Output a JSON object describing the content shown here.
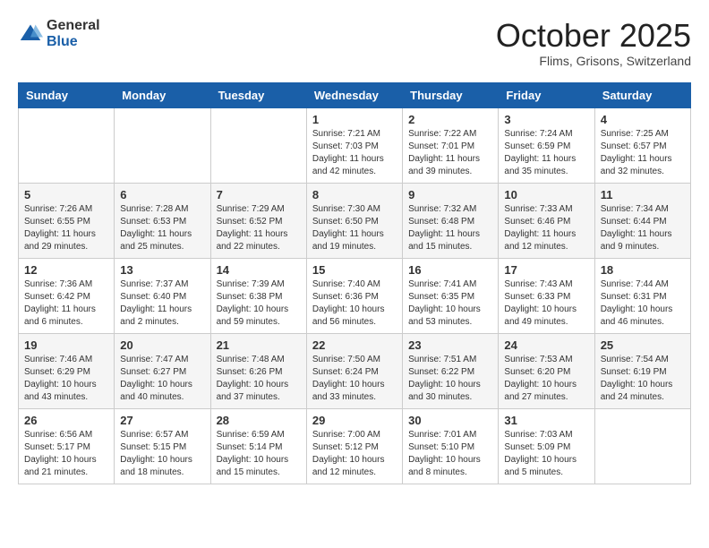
{
  "header": {
    "logo_general": "General",
    "logo_blue": "Blue",
    "month": "October 2025",
    "location": "Flims, Grisons, Switzerland"
  },
  "weekdays": [
    "Sunday",
    "Monday",
    "Tuesday",
    "Wednesday",
    "Thursday",
    "Friday",
    "Saturday"
  ],
  "rows": [
    {
      "style": "white",
      "cells": [
        {
          "day": "",
          "info": ""
        },
        {
          "day": "",
          "info": ""
        },
        {
          "day": "",
          "info": ""
        },
        {
          "day": "1",
          "info": "Sunrise: 7:21 AM\nSunset: 7:03 PM\nDaylight: 11 hours\nand 42 minutes."
        },
        {
          "day": "2",
          "info": "Sunrise: 7:22 AM\nSunset: 7:01 PM\nDaylight: 11 hours\nand 39 minutes."
        },
        {
          "day": "3",
          "info": "Sunrise: 7:24 AM\nSunset: 6:59 PM\nDaylight: 11 hours\nand 35 minutes."
        },
        {
          "day": "4",
          "info": "Sunrise: 7:25 AM\nSunset: 6:57 PM\nDaylight: 11 hours\nand 32 minutes."
        }
      ]
    },
    {
      "style": "gray",
      "cells": [
        {
          "day": "5",
          "info": "Sunrise: 7:26 AM\nSunset: 6:55 PM\nDaylight: 11 hours\nand 29 minutes."
        },
        {
          "day": "6",
          "info": "Sunrise: 7:28 AM\nSunset: 6:53 PM\nDaylight: 11 hours\nand 25 minutes."
        },
        {
          "day": "7",
          "info": "Sunrise: 7:29 AM\nSunset: 6:52 PM\nDaylight: 11 hours\nand 22 minutes."
        },
        {
          "day": "8",
          "info": "Sunrise: 7:30 AM\nSunset: 6:50 PM\nDaylight: 11 hours\nand 19 minutes."
        },
        {
          "day": "9",
          "info": "Sunrise: 7:32 AM\nSunset: 6:48 PM\nDaylight: 11 hours\nand 15 minutes."
        },
        {
          "day": "10",
          "info": "Sunrise: 7:33 AM\nSunset: 6:46 PM\nDaylight: 11 hours\nand 12 minutes."
        },
        {
          "day": "11",
          "info": "Sunrise: 7:34 AM\nSunset: 6:44 PM\nDaylight: 11 hours\nand 9 minutes."
        }
      ]
    },
    {
      "style": "white",
      "cells": [
        {
          "day": "12",
          "info": "Sunrise: 7:36 AM\nSunset: 6:42 PM\nDaylight: 11 hours\nand 6 minutes."
        },
        {
          "day": "13",
          "info": "Sunrise: 7:37 AM\nSunset: 6:40 PM\nDaylight: 11 hours\nand 2 minutes."
        },
        {
          "day": "14",
          "info": "Sunrise: 7:39 AM\nSunset: 6:38 PM\nDaylight: 10 hours\nand 59 minutes."
        },
        {
          "day": "15",
          "info": "Sunrise: 7:40 AM\nSunset: 6:36 PM\nDaylight: 10 hours\nand 56 minutes."
        },
        {
          "day": "16",
          "info": "Sunrise: 7:41 AM\nSunset: 6:35 PM\nDaylight: 10 hours\nand 53 minutes."
        },
        {
          "day": "17",
          "info": "Sunrise: 7:43 AM\nSunset: 6:33 PM\nDaylight: 10 hours\nand 49 minutes."
        },
        {
          "day": "18",
          "info": "Sunrise: 7:44 AM\nSunset: 6:31 PM\nDaylight: 10 hours\nand 46 minutes."
        }
      ]
    },
    {
      "style": "gray",
      "cells": [
        {
          "day": "19",
          "info": "Sunrise: 7:46 AM\nSunset: 6:29 PM\nDaylight: 10 hours\nand 43 minutes."
        },
        {
          "day": "20",
          "info": "Sunrise: 7:47 AM\nSunset: 6:27 PM\nDaylight: 10 hours\nand 40 minutes."
        },
        {
          "day": "21",
          "info": "Sunrise: 7:48 AM\nSunset: 6:26 PM\nDaylight: 10 hours\nand 37 minutes."
        },
        {
          "day": "22",
          "info": "Sunrise: 7:50 AM\nSunset: 6:24 PM\nDaylight: 10 hours\nand 33 minutes."
        },
        {
          "day": "23",
          "info": "Sunrise: 7:51 AM\nSunset: 6:22 PM\nDaylight: 10 hours\nand 30 minutes."
        },
        {
          "day": "24",
          "info": "Sunrise: 7:53 AM\nSunset: 6:20 PM\nDaylight: 10 hours\nand 27 minutes."
        },
        {
          "day": "25",
          "info": "Sunrise: 7:54 AM\nSunset: 6:19 PM\nDaylight: 10 hours\nand 24 minutes."
        }
      ]
    },
    {
      "style": "white",
      "cells": [
        {
          "day": "26",
          "info": "Sunrise: 6:56 AM\nSunset: 5:17 PM\nDaylight: 10 hours\nand 21 minutes."
        },
        {
          "day": "27",
          "info": "Sunrise: 6:57 AM\nSunset: 5:15 PM\nDaylight: 10 hours\nand 18 minutes."
        },
        {
          "day": "28",
          "info": "Sunrise: 6:59 AM\nSunset: 5:14 PM\nDaylight: 10 hours\nand 15 minutes."
        },
        {
          "day": "29",
          "info": "Sunrise: 7:00 AM\nSunset: 5:12 PM\nDaylight: 10 hours\nand 12 minutes."
        },
        {
          "day": "30",
          "info": "Sunrise: 7:01 AM\nSunset: 5:10 PM\nDaylight: 10 hours\nand 8 minutes."
        },
        {
          "day": "31",
          "info": "Sunrise: 7:03 AM\nSunset: 5:09 PM\nDaylight: 10 hours\nand 5 minutes."
        },
        {
          "day": "",
          "info": ""
        }
      ]
    }
  ]
}
